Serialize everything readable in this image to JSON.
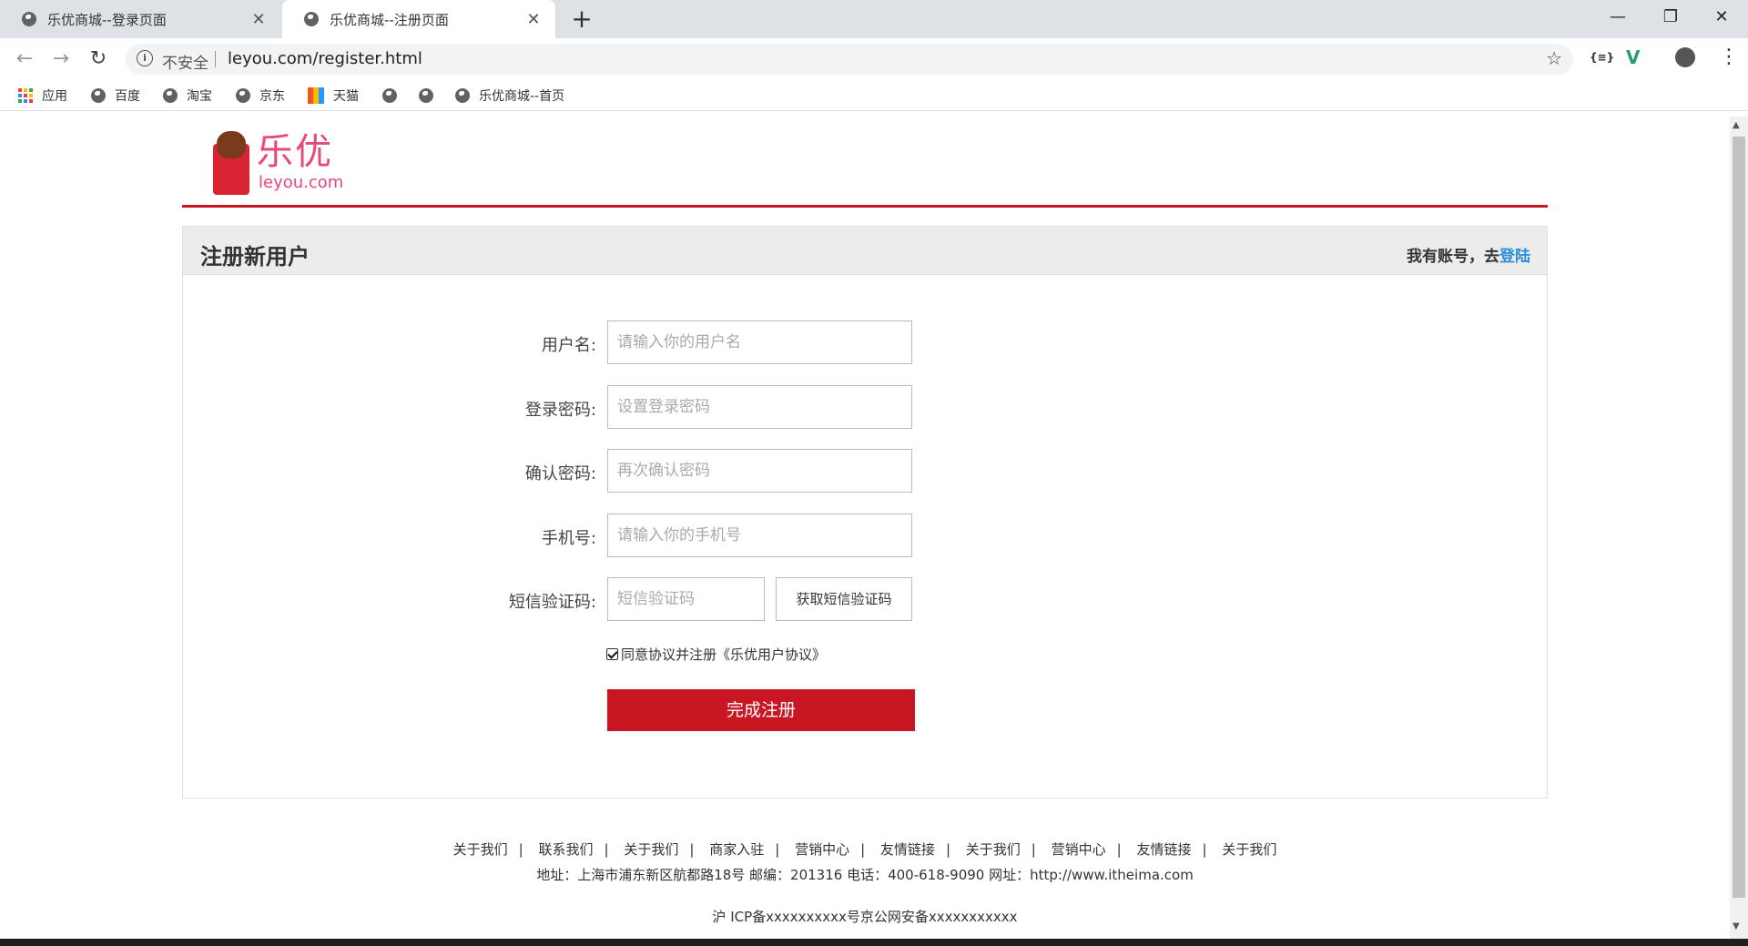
{
  "browser": {
    "tabs": [
      {
        "title": "乐优商城--登录页面",
        "close": "✕"
      },
      {
        "title": "乐优商城--注册页面",
        "close": "✕"
      }
    ],
    "new_tab": "+",
    "window_controls": {
      "minimize": "—",
      "restore": "❐",
      "close": "✕"
    },
    "nav": {
      "back": "←",
      "forward": "→",
      "reload": "↻"
    },
    "security_label": "不安全",
    "url": "leyou.com/register.html",
    "extensions": {
      "ext1": "{≡}",
      "ext2": "V",
      "menu": "⋮"
    },
    "bookmarks": [
      {
        "label": "应用",
        "icon": "apps-grid-icon"
      },
      {
        "label": "百度",
        "icon": "globe-icon"
      },
      {
        "label": "淘宝",
        "icon": "globe-icon"
      },
      {
        "label": "京东",
        "icon": "globe-icon"
      },
      {
        "label": "天猫",
        "icon": "tmall-icon"
      },
      {
        "label": "",
        "icon": "globe-icon"
      },
      {
        "label": "",
        "icon": "globe-icon"
      },
      {
        "label": "乐优商城--首页",
        "icon": "globe-icon"
      }
    ]
  },
  "logo": {
    "cn": "乐优",
    "en": "leyou.com"
  },
  "panel": {
    "title": "注册新用户",
    "login_prompt": "我有账号，去",
    "login_link": "登陆"
  },
  "form": {
    "username": {
      "label": "用户名:",
      "placeholder": "请输入你的用户名"
    },
    "password": {
      "label": "登录密码:",
      "placeholder": "设置登录密码"
    },
    "confirm": {
      "label": "确认密码:",
      "placeholder": "再次确认密码"
    },
    "phone": {
      "label": "手机号:",
      "placeholder": "请输入你的手机号"
    },
    "sms": {
      "label": "短信验证码:",
      "placeholder": "短信验证码",
      "button": "获取短信验证码"
    },
    "agree_text": "同意协议并注册《乐优用户协议》",
    "agree_checked": true,
    "submit": "完成注册"
  },
  "footer": {
    "links": [
      "关于我们",
      "联系我们",
      "关于我们",
      "商家入驻",
      "营销中心",
      "友情链接",
      "关于我们",
      "营销中心",
      "友情链接",
      "关于我们"
    ],
    "address": "地址：上海市浦东新区航都路18号 邮编：201316 电话：400-618-9090 网址：http://www.itheima.com",
    "icp": "沪 ICP备xxxxxxxxxx号京公网安备xxxxxxxxxxx"
  },
  "colors": {
    "brand_red": "#c81623",
    "link_blue": "#2b8ddb",
    "logo_pink": "#e8467c"
  }
}
